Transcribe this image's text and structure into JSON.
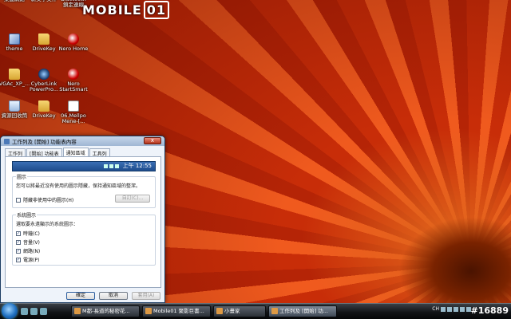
{
  "logo": {
    "text": "MOBILE",
    "box": "01"
  },
  "desktop_icons": [
    {
      "label": "桌面網路",
      "col": 0,
      "row": 0,
      "kind": "prog"
    },
    {
      "label": "新文字文件",
      "col": 1,
      "row": 0,
      "kind": "doc"
    },
    {
      "label": "Bluetooth 鎖定連線",
      "col": 2,
      "row": 0,
      "kind": "prog"
    },
    {
      "label": "theme",
      "col": 0,
      "row": 1,
      "kind": "prog"
    },
    {
      "label": "DriveKey",
      "col": 1,
      "row": 1,
      "kind": "folder"
    },
    {
      "label": "Nero Home",
      "col": 2,
      "row": 1,
      "kind": "nero"
    },
    {
      "label": "VGAc_XP_...",
      "col": 0,
      "row": 2,
      "kind": "folder"
    },
    {
      "label": "CyberLink PowerPro...",
      "col": 1,
      "row": 2,
      "kind": "cyber"
    },
    {
      "label": "Nero StartSmart",
      "col": 2,
      "row": 2,
      "kind": "nero"
    },
    {
      "label": "資源回收筒",
      "col": 0,
      "row": 3,
      "kind": "recycle"
    },
    {
      "label": "DriveKey",
      "col": 1,
      "row": 3,
      "kind": "folder"
    },
    {
      "label": "06.Mellpo Mene-[...",
      "col": 2,
      "row": 3,
      "kind": "doc"
    }
  ],
  "dialog": {
    "title": "工作列及 [開始] 功能表內容",
    "close": "x",
    "tabs": [
      "工作列",
      "[開始] 功能表",
      "通知區域",
      "工具列"
    ],
    "active_tab": 2,
    "preview_time": "上午 12:55",
    "group1": {
      "title": "圖示",
      "desc": "您可以將最近沒有使用的圖示隱藏，保持通知區域的整潔。",
      "checkbox": "隱藏非使用中的圖示(H)",
      "checked": false,
      "customize": "自訂(C)..."
    },
    "group2": {
      "title": "系統圖示",
      "desc": "選取要永遠顯示的系統圖示：",
      "items": [
        {
          "label": "時鐘(C)",
          "checked": true
        },
        {
          "label": "音量(V)",
          "checked": true
        },
        {
          "label": "網路(N)",
          "checked": true
        },
        {
          "label": "電源(P)",
          "checked": true
        }
      ]
    },
    "buttons": {
      "ok": "確定",
      "cancel": "取消",
      "apply": "套用(A)"
    }
  },
  "taskbar": {
    "tasks": [
      {
        "label": "M都-長道的秘密花...",
        "active": false
      },
      {
        "label": "Mobile01 聚影巨書...",
        "active": false
      },
      {
        "label": "小畫家",
        "active": false
      },
      {
        "label": "工作列及 [開始] 功...",
        "active": true
      }
    ],
    "language": "CH",
    "watermark": "#16889"
  }
}
